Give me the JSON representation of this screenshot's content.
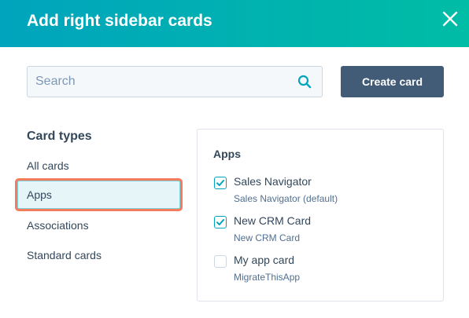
{
  "dialog": {
    "title": "Add right sidebar cards"
  },
  "search": {
    "placeholder": "Search",
    "value": ""
  },
  "toolbar": {
    "create_label": "Create card"
  },
  "card_types": {
    "heading": "Card types",
    "items": [
      {
        "label": "All cards",
        "selected": false
      },
      {
        "label": "Apps",
        "selected": true
      },
      {
        "label": "Associations",
        "selected": false
      },
      {
        "label": "Standard cards",
        "selected": false
      }
    ]
  },
  "apps_panel": {
    "heading": "Apps",
    "apps": [
      {
        "name": "Sales Navigator",
        "subtitle": "Sales Navigator (default)",
        "checked": true
      },
      {
        "name": "New CRM Card",
        "subtitle": "New CRM Card",
        "checked": true
      },
      {
        "name": "My app card",
        "subtitle": "MigrateThisApp",
        "checked": false
      }
    ]
  },
  "colors": {
    "header_gradient_start": "#00a4bd",
    "header_gradient_end": "#00bda5",
    "primary_button": "#425b76",
    "highlight_outline": "#f47c5a",
    "checkbox_accent": "#00a4bd"
  },
  "icons": {
    "close": "close-icon",
    "search": "search-icon",
    "check": "checkmark-icon"
  }
}
